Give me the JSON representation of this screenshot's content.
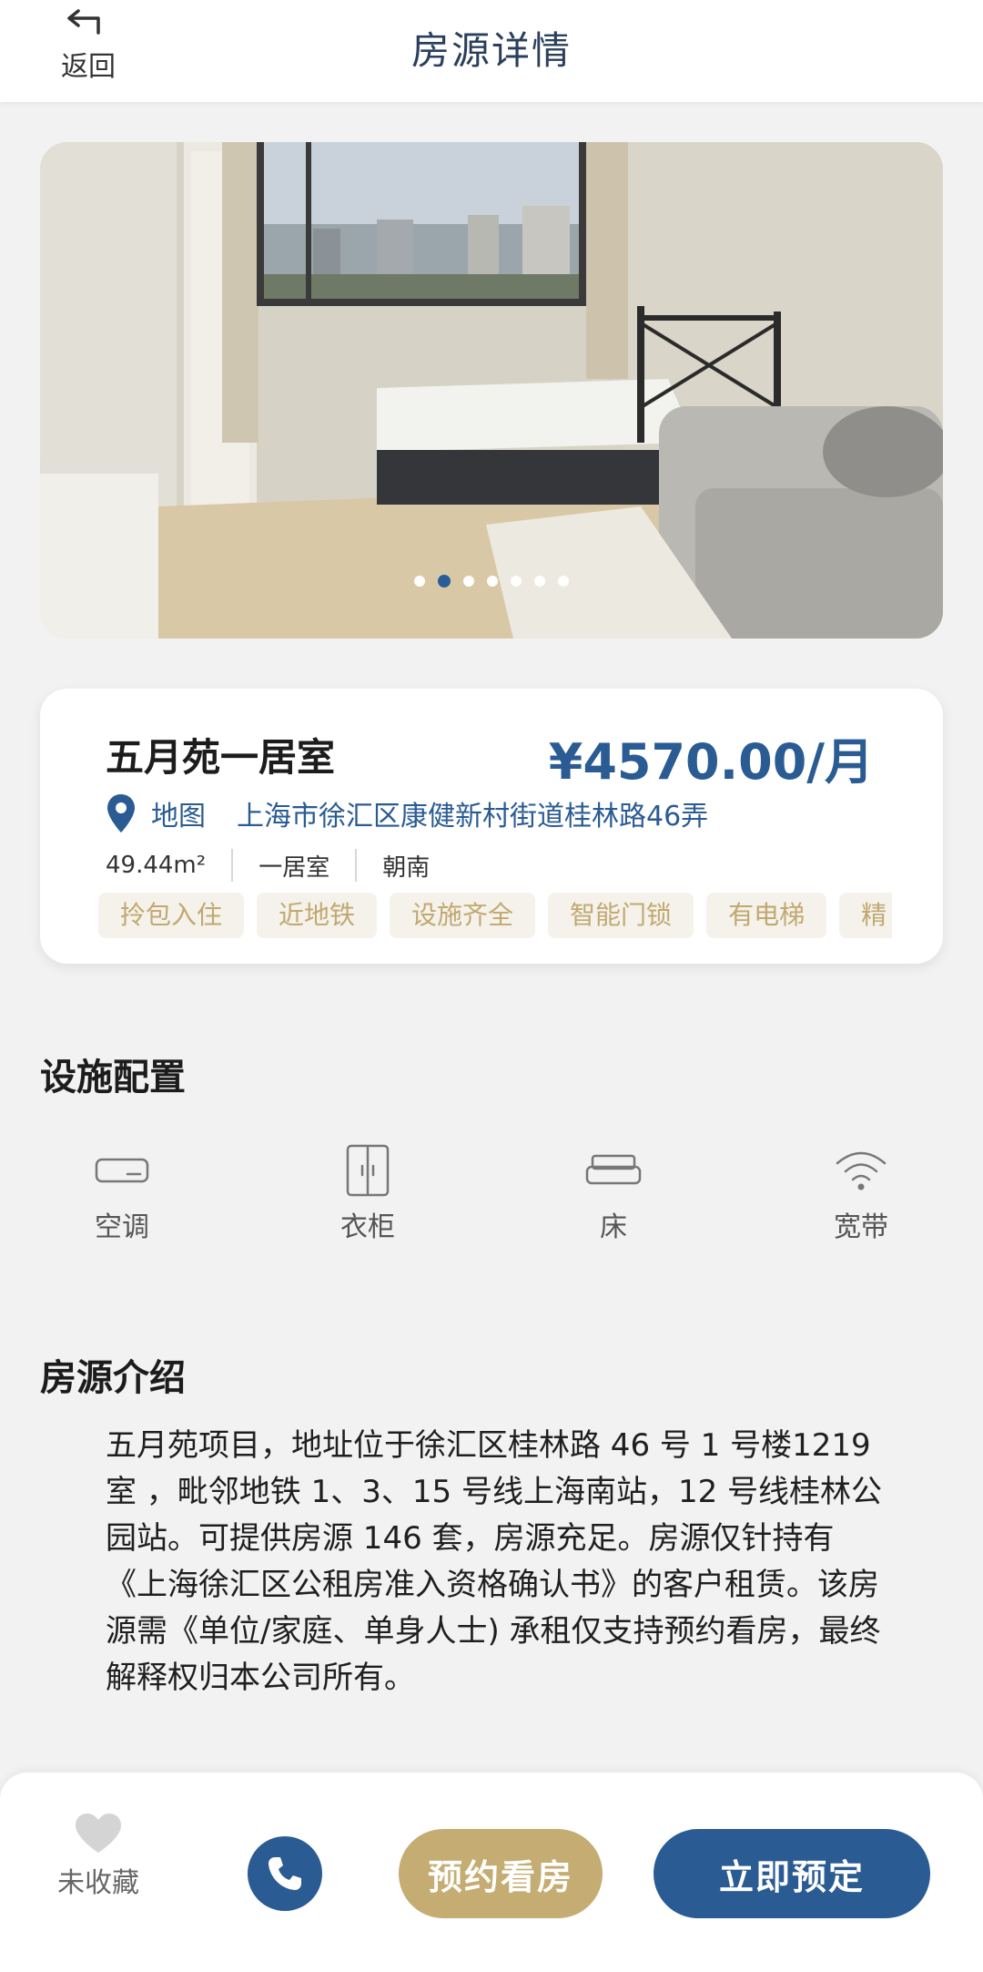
{
  "header": {
    "back_label": "返回",
    "title": "房源详情"
  },
  "gallery": {
    "count": 7,
    "active_index": 1
  },
  "listing": {
    "name": "五月苑一居室",
    "price": "¥4570.00/月",
    "map_label": "地图",
    "address": "上海市徐汇区康健新村街道桂林路46弄",
    "area": "49.44m²",
    "layout": "一居室",
    "orientation": "朝南",
    "tags": [
      "拎包入住",
      "近地铁",
      "设施齐全",
      "智能门锁",
      "有电梯",
      "精"
    ]
  },
  "facilities": {
    "title": "设施配置",
    "items": [
      {
        "label": "空调",
        "icon": "air-conditioner-icon"
      },
      {
        "label": "衣柜",
        "icon": "wardrobe-icon"
      },
      {
        "label": "床",
        "icon": "bed-icon"
      },
      {
        "label": "宽带",
        "icon": "wifi-icon"
      }
    ]
  },
  "intro": {
    "title": "房源介绍",
    "text": "五月苑项目，地址位于徐汇区桂林路 46 号 1 号楼1219室 ，毗邻地铁 1、3、15 号线上海南站，12 号线桂林公园站。可提供房源 146 套，房源充足。房源仅针持有《上海徐汇区公租房准入资格确认书》的客户租赁。该房源需《单位/家庭、单身人士) 承租仅支持预约看房，最终解释权归本公司所有。"
  },
  "bottom_bar": {
    "favorite_label": "未收藏",
    "visit_button": "预约看房",
    "book_button": "立即预定"
  },
  "colors": {
    "primary_blue": "#2a5b93",
    "gold": "#c4ac72",
    "tag_text": "#c2a871",
    "tag_bg": "#f4f2ea",
    "page_bg": "#f2f2f2"
  }
}
